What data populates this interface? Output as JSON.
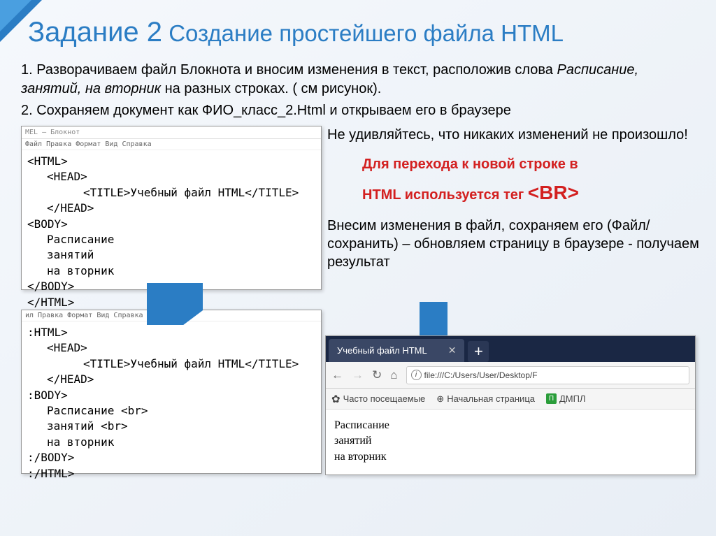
{
  "title": {
    "prefix": "Задание 2",
    "rest": " Создание простейшего файла HTML"
  },
  "step1": {
    "label": "1. Разворачиваем файл Блокнота и вносим изменения в текст, расположив слова ",
    "italic": "Расписание, занятий, на вторник",
    "rest": " на разных строках. ( см рисунок)."
  },
  "step2": "2. Сохраняем документ как ФИО_класс_2.Html и открываем его в браузере",
  "notepad1": {
    "titlebar": "MEL — Блокнот",
    "menu": "Файл Правка Формат Вид Справка",
    "lines": {
      "l1": "<HTML>",
      "l2": "<HEAD>",
      "l3": "<TITLE>Учебный файл HTML</TITLE>",
      "l4": "</HEAD>",
      "l5": "<BODY>",
      "l6": "Расписание",
      "l7": "занятий",
      "l8": "на вторник",
      "l9": "</BODY>",
      "l10": "</HTML>"
    }
  },
  "notepad2": {
    "menu": "ил Правка Формат Вид Справка",
    "lines": {
      "l1": ":HTML>",
      "l2": "<HEAD>",
      "l3": "<TITLE>Учебный файл HTML</TITLE>",
      "l4": "</HEAD>",
      "l5": ":BODY>",
      "l6": "Расписание <br>",
      "l7": "занятий <br>",
      "l8": "на вторник",
      "l9": ":/BODY>",
      "l10": ":/HTML>"
    }
  },
  "side": {
    "surprise": "Не удивляйтесь, что никаких изменений не произошло!",
    "red_line1": "Для перехода к новой строке в",
    "red_line2": "HTML используется тег ",
    "br_tag": "<BR>",
    "action": "Внесим изменения в файл, сохраняем его (Файл/сохранить) – обновляем страницу в браузере - получаем результат"
  },
  "browser": {
    "tab_title": "Учебный файл HTML",
    "url": "file:///C:/Users/User/Desktop/F",
    "bookmarks": {
      "freq": "Часто посещаемые",
      "start": "Начальная страница",
      "dmpl": "ДМПЛ"
    },
    "content": {
      "l1": "Расписание",
      "l2": "занятий",
      "l3": "на вторник"
    }
  }
}
